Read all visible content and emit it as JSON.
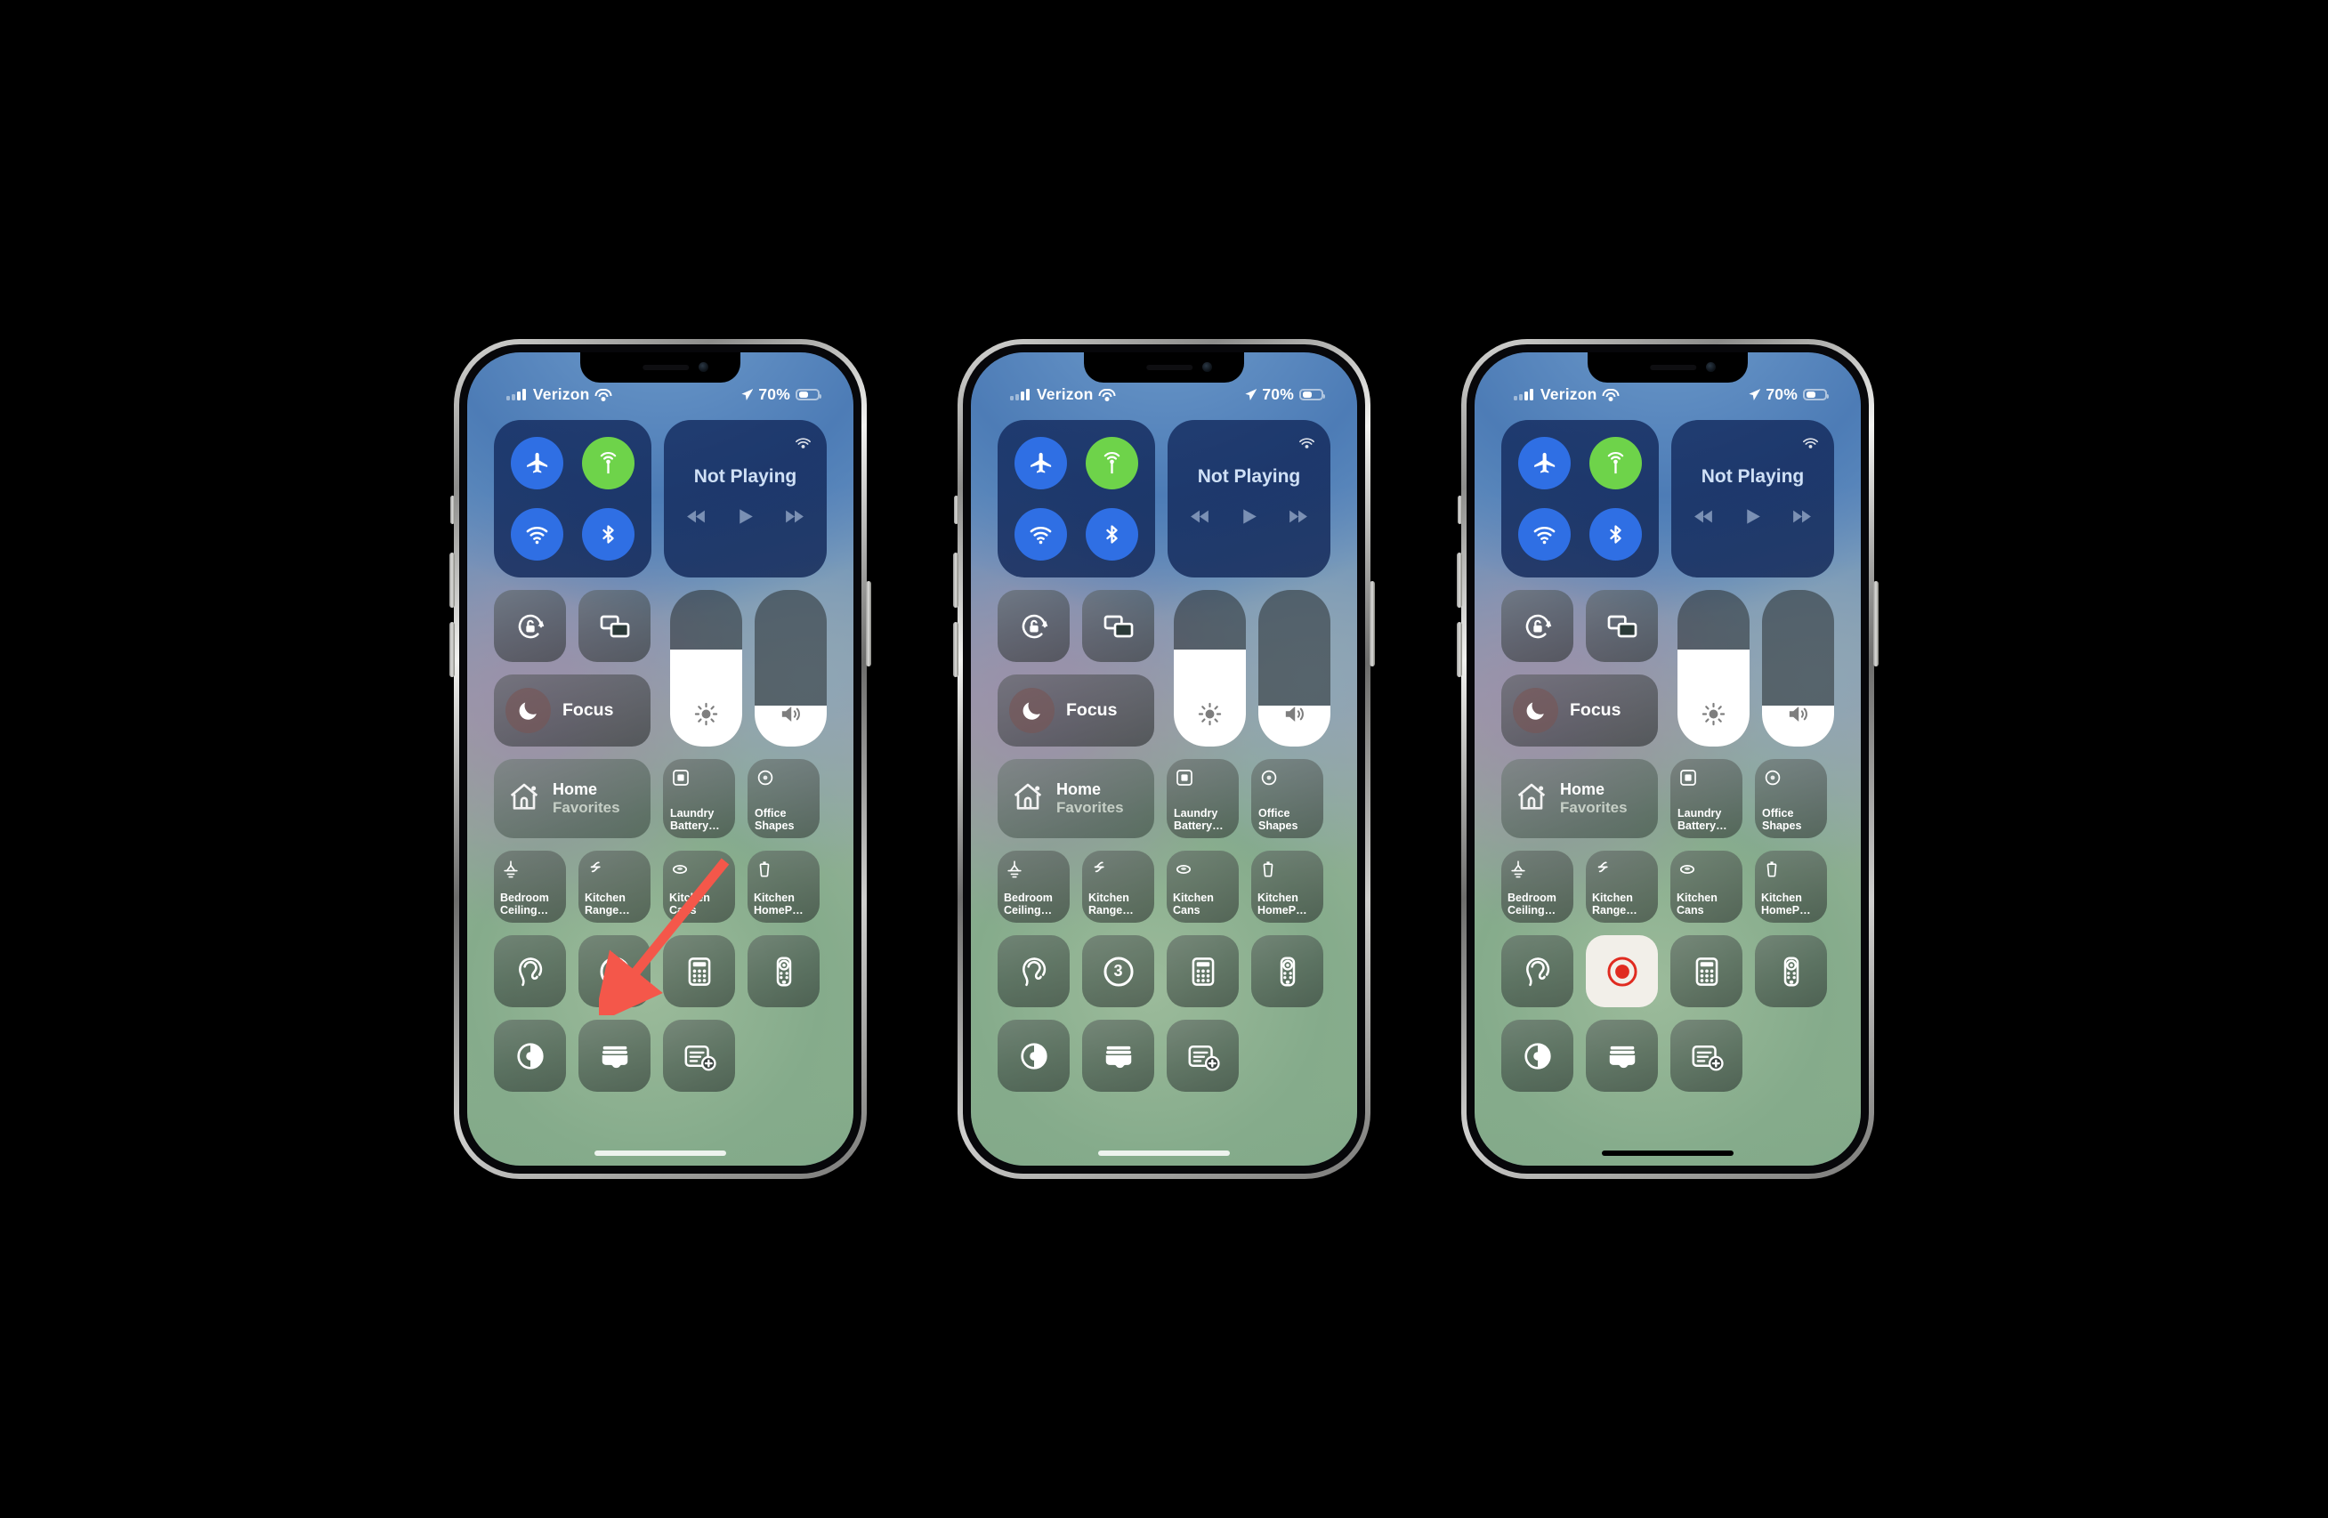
{
  "scene": {
    "description": "iOS Control Center shown on three iPhones illustrating how to start a screen recording",
    "phone_count": 3,
    "highlight_color": "#ef4136",
    "annotation_arrow": "red-arrow-pointing-to-screen-record-button"
  },
  "status_bar": {
    "carrier": "Verizon",
    "signal_icon": "cellular-bars-icon",
    "wifi_icon": "wifi-icon",
    "location_icon": "location-arrow-icon",
    "battery_percent": "70%",
    "battery_icon": "battery-icon",
    "battery_level": 70
  },
  "connectivity": {
    "airplane": {
      "label": "Airplane Mode",
      "icon": "airplane-icon",
      "state": "on",
      "color": "#2f6fe4"
    },
    "cellular": {
      "label": "Cellular Data",
      "icon": "cellular-antenna-icon",
      "state": "on",
      "color": "#6ed34a"
    },
    "wifi": {
      "label": "Wi-Fi",
      "icon": "wifi-icon",
      "state": "on",
      "color": "#2f6fe4"
    },
    "bluetooth": {
      "label": "Bluetooth",
      "icon": "bluetooth-icon",
      "state": "on",
      "color": "#2f6fe4"
    }
  },
  "media": {
    "title": "Not Playing",
    "airplay_icon": "airplay-audio-icon",
    "rewind_icon": "rewind-icon",
    "play_icon": "play-icon",
    "forward_icon": "fast-forward-icon"
  },
  "quick_toggles": {
    "rotation_lock": {
      "label": "Rotation Lock",
      "icon": "rotation-lock-icon"
    },
    "screen_mirroring": {
      "label": "Screen Mirroring",
      "icon": "screen-mirroring-icon"
    },
    "focus": {
      "label": "Focus",
      "icon": "moon-icon"
    }
  },
  "sliders": {
    "brightness": {
      "label": "Brightness",
      "icon": "brightness-sun-icon",
      "value": 62
    },
    "volume": {
      "label": "Volume",
      "icon": "speaker-volume-icon",
      "value": 26
    }
  },
  "home": {
    "title": "Home",
    "subtitle": "Favorites",
    "icon": "home-house-icon",
    "accessories": [
      {
        "name": "Laundry Battery…",
        "icon": "sensor-square-icon"
      },
      {
        "name": "Office Shapes",
        "icon": "lightbulb-circle-icon"
      }
    ],
    "devices": [
      {
        "name": "Bedroom Ceiling…",
        "icon": "ceiling-light-icon"
      },
      {
        "name": "Kitchen Range…",
        "icon": "range-hood-icon"
      },
      {
        "name": "Kitchen Cans",
        "icon": "recessed-light-icon"
      },
      {
        "name": "Kitchen HomeP…",
        "icon": "homepod-icon"
      }
    ]
  },
  "controls_row": {
    "hearing": {
      "label": "Hearing",
      "icon": "ear-hearing-icon"
    },
    "screen_record": {
      "label": "Screen Recording",
      "icon": "record-circle-icon"
    },
    "calculator": {
      "label": "Calculator",
      "icon": "calculator-icon"
    },
    "remote": {
      "label": "Apple TV Remote",
      "icon": "tv-remote-icon"
    }
  },
  "bottom_row": {
    "dark_mode": {
      "label": "Dark Mode",
      "icon": "dark-mode-circle-icon"
    },
    "wallet": {
      "label": "Wallet",
      "icon": "wallet-cards-icon"
    },
    "notes": {
      "label": "Quick Note",
      "icon": "note-add-icon"
    }
  },
  "phones": [
    {
      "id": "phone-1",
      "caption_state": "idle",
      "screen_record_state": "idle",
      "record_highlight": true,
      "record_countdown": "",
      "arrow_annotation": true,
      "home_indicator": "light"
    },
    {
      "id": "phone-2",
      "caption_state": "counting-down",
      "screen_record_state": "countdown",
      "record_highlight": true,
      "record_countdown": "3",
      "arrow_annotation": false,
      "home_indicator": "light"
    },
    {
      "id": "phone-3",
      "caption_state": "recording",
      "screen_record_state": "recording",
      "record_highlight": true,
      "record_countdown": "",
      "arrow_annotation": false,
      "home_indicator": "dark"
    }
  ]
}
